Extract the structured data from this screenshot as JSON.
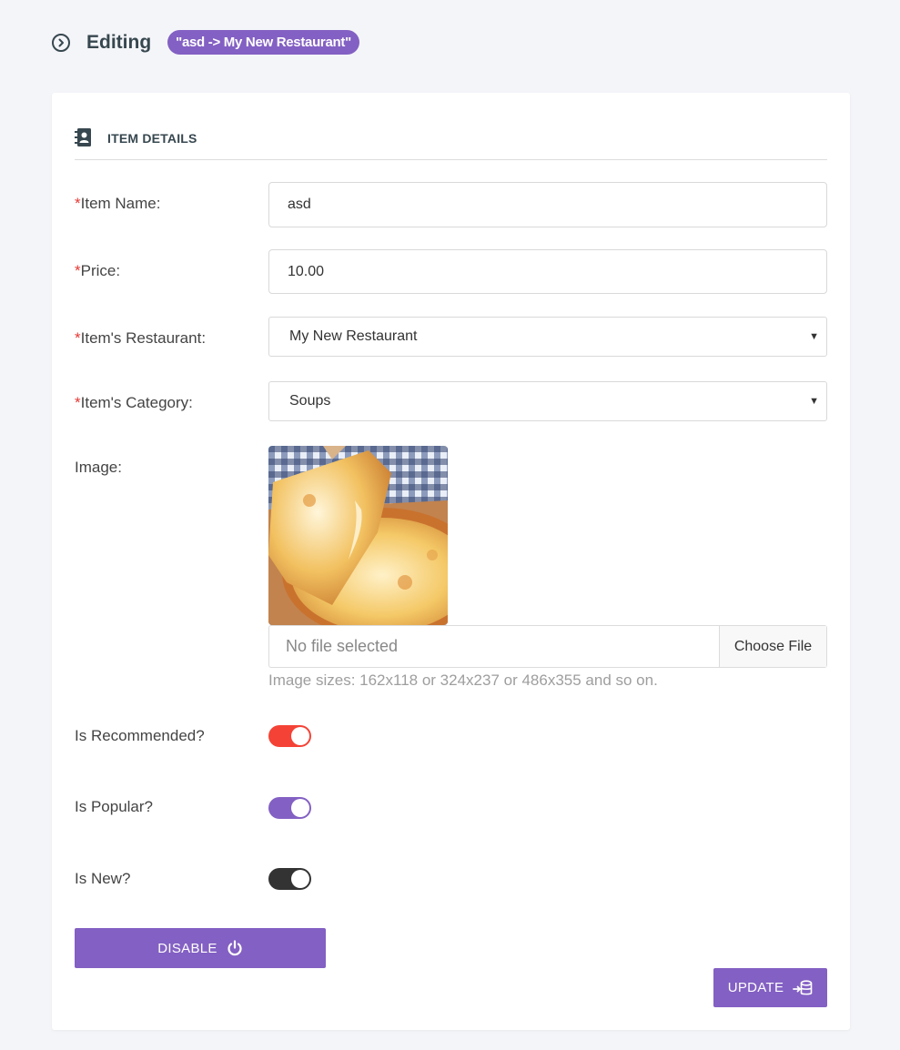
{
  "header": {
    "title": "Editing",
    "badge": "\"asd -> My New Restaurant\""
  },
  "section": {
    "title": "ITEM DETAILS"
  },
  "fields": {
    "item_name": {
      "required_mark": "*",
      "label": "Item Name:",
      "value": "asd"
    },
    "price": {
      "required_mark": "*",
      "label": "Price:",
      "value": "10.00"
    },
    "restaurant": {
      "required_mark": "*",
      "label": "Item's Restaurant:",
      "value": "My New Restaurant"
    },
    "category": {
      "required_mark": "*",
      "label": "Item's Category:",
      "value": "Soups"
    },
    "image": {
      "label": "Image:",
      "file_status": "No file selected",
      "choose_label": "Choose File",
      "hint": "Image sizes: 162x118 or 324x237 or 486x355 and so on."
    }
  },
  "toggles": {
    "recommended": {
      "label": "Is Recommended?",
      "on": true,
      "color": "#f44336"
    },
    "popular": {
      "label": "Is Popular?",
      "on": true,
      "color": "#8360c3"
    },
    "new": {
      "label": "Is New?",
      "on": true,
      "color": "#333333"
    }
  },
  "buttons": {
    "disable_label": "DISABLE",
    "update_label": "UPDATE"
  },
  "colors": {
    "accent": "#8360c3",
    "required": "#e53935",
    "background": "#f4f5f9"
  }
}
